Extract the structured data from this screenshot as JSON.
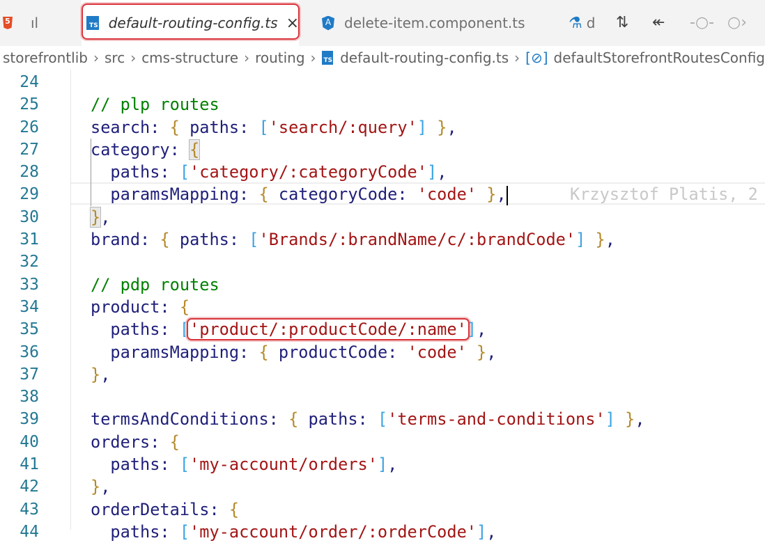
{
  "tabs": [
    {
      "label": "ıl",
      "icon": "html5-icon"
    },
    {
      "label": "default-routing-config.ts",
      "icon": "typescript-icon",
      "active": true,
      "close": "×"
    },
    {
      "label": "delete-item.component.ts",
      "icon": "angular-icon"
    },
    {
      "label": "d",
      "icon": "flask-icon"
    }
  ],
  "toolbar": {
    "icons": [
      "compare-changes-icon",
      "go-to-previous-change-icon",
      "toggle-inline-icon",
      "go-to-next-change-icon"
    ]
  },
  "breadcrumbs": [
    "storefrontlib",
    "src",
    "cms-structure",
    "routing",
    "default-routing-config.ts",
    "defaultStorefrontRoutesConfig"
  ],
  "ts_badge": "TS",
  "colors": {
    "comment": "#008000",
    "string": "#a31515",
    "property": "#1f1f7a",
    "brace": "#b5892a",
    "bracket": "#3aa3e3",
    "linenumber": "#237893",
    "highlight": "#d9343b"
  },
  "editor": {
    "blame": "Krzysztof Platis, 2",
    "lines": [
      {
        "n": "24",
        "i": 0,
        "t": []
      },
      {
        "n": "25",
        "i": 0,
        "t": [
          [
            "c",
            "// plp routes"
          ]
        ]
      },
      {
        "n": "26",
        "i": 0,
        "t": [
          [
            "p",
            "search: "
          ],
          [
            "b",
            "{"
          ],
          [
            "p",
            " paths: "
          ],
          [
            "k",
            "["
          ],
          [
            "s",
            "'search/:query'"
          ],
          [
            "k",
            "]"
          ],
          [
            "p",
            " "
          ],
          [
            "b",
            "}"
          ],
          [
            "p",
            ","
          ]
        ]
      },
      {
        "n": "27",
        "i": 0,
        "t": [
          [
            "p",
            "category: "
          ],
          [
            "b",
            "{",
            "m"
          ]
        ]
      },
      {
        "n": "28",
        "i": 1,
        "t": [
          [
            "p",
            "paths: "
          ],
          [
            "k",
            "["
          ],
          [
            "s",
            "'category/:categoryCode'"
          ],
          [
            "k",
            "]"
          ],
          [
            "p",
            ","
          ]
        ]
      },
      {
        "n": "29",
        "i": 1,
        "t": [
          [
            "p",
            "paramsMapping: "
          ],
          [
            "b",
            "{"
          ],
          [
            "p",
            " categoryCode: "
          ],
          [
            "s",
            "'code'"
          ],
          [
            "p",
            " "
          ],
          [
            "b",
            "}"
          ],
          [
            "p",
            ","
          ]
        ],
        "cursor": true
      },
      {
        "n": "30",
        "i": 0,
        "t": [
          [
            "b",
            "}",
            "m"
          ],
          [
            "p",
            ","
          ]
        ]
      },
      {
        "n": "31",
        "i": 0,
        "t": [
          [
            "p",
            "brand: "
          ],
          [
            "b",
            "{"
          ],
          [
            "p",
            " paths: "
          ],
          [
            "k",
            "["
          ],
          [
            "s",
            "'Brands/:brandName/c/:brandCode'"
          ],
          [
            "k",
            "]"
          ],
          [
            "p",
            " "
          ],
          [
            "b",
            "}"
          ],
          [
            "p",
            ","
          ]
        ]
      },
      {
        "n": "32",
        "i": 0,
        "t": []
      },
      {
        "n": "33",
        "i": 0,
        "t": [
          [
            "c",
            "// pdp routes"
          ]
        ]
      },
      {
        "n": "34",
        "i": 0,
        "t": [
          [
            "p",
            "product: "
          ],
          [
            "b",
            "{"
          ]
        ]
      },
      {
        "n": "35",
        "i": 1,
        "t": [
          [
            "p",
            "paths: "
          ],
          [
            "k",
            "["
          ],
          [
            "s",
            "'product/:productCode/:name'",
            "h"
          ],
          [
            "k",
            "]"
          ],
          [
            "p",
            ","
          ]
        ]
      },
      {
        "n": "36",
        "i": 1,
        "t": [
          [
            "p",
            "paramsMapping: "
          ],
          [
            "b",
            "{"
          ],
          [
            "p",
            " productCode: "
          ],
          [
            "s",
            "'code'"
          ],
          [
            "p",
            " "
          ],
          [
            "b",
            "}"
          ],
          [
            "p",
            ","
          ]
        ]
      },
      {
        "n": "37",
        "i": 0,
        "t": [
          [
            "b",
            "}"
          ],
          [
            "p",
            ","
          ]
        ]
      },
      {
        "n": "38",
        "i": 0,
        "t": []
      },
      {
        "n": "39",
        "i": 0,
        "t": [
          [
            "p",
            "termsAndConditions: "
          ],
          [
            "b",
            "{"
          ],
          [
            "p",
            " paths: "
          ],
          [
            "k",
            "["
          ],
          [
            "s",
            "'terms-and-conditions'"
          ],
          [
            "k",
            "]"
          ],
          [
            "p",
            " "
          ],
          [
            "b",
            "}"
          ],
          [
            "p",
            ","
          ]
        ]
      },
      {
        "n": "40",
        "i": 0,
        "t": [
          [
            "p",
            "orders: "
          ],
          [
            "b",
            "{"
          ]
        ]
      },
      {
        "n": "41",
        "i": 1,
        "t": [
          [
            "p",
            "paths: "
          ],
          [
            "k",
            "["
          ],
          [
            "s",
            "'my-account/orders'"
          ],
          [
            "k",
            "]"
          ],
          [
            "p",
            ","
          ]
        ]
      },
      {
        "n": "42",
        "i": 0,
        "t": [
          [
            "b",
            "}"
          ],
          [
            "p",
            ","
          ]
        ]
      },
      {
        "n": "43",
        "i": 0,
        "t": [
          [
            "p",
            "orderDetails: "
          ],
          [
            "b",
            "{"
          ]
        ]
      },
      {
        "n": "44",
        "i": 1,
        "t": [
          [
            "p",
            "paths: "
          ],
          [
            "k",
            "["
          ],
          [
            "s",
            "'my-account/order/:orderCode'"
          ],
          [
            "k",
            "]"
          ],
          [
            "p",
            ","
          ]
        ]
      }
    ]
  }
}
